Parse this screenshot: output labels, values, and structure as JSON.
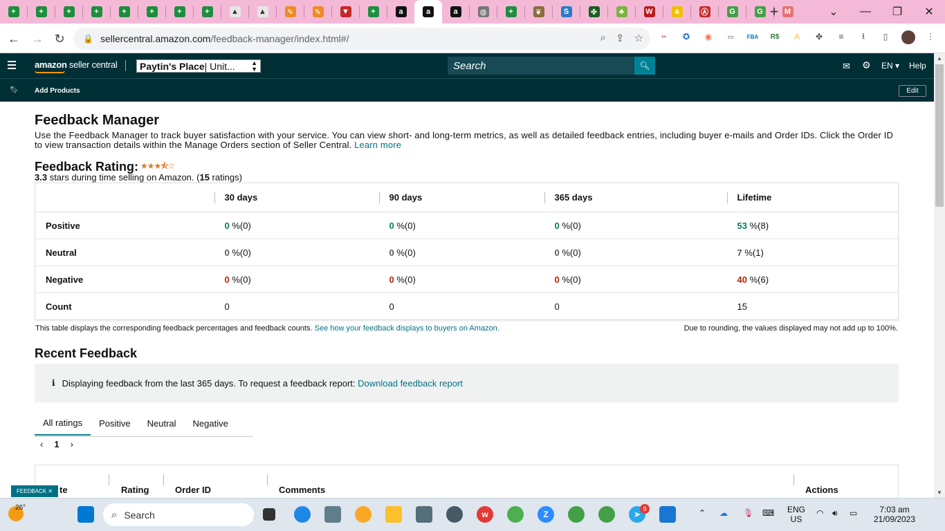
{
  "browser": {
    "url_host": "sellercentral.amazon.com",
    "url_path": "/feedback-manager/index.html#/",
    "tabs": [
      {
        "icon": "sheets-icon",
        "color": "#1e8e3e",
        "glyph": "+"
      },
      {
        "icon": "sheets-icon",
        "color": "#1e8e3e",
        "glyph": "+"
      },
      {
        "icon": "sheets-icon",
        "color": "#1e8e3e",
        "glyph": "+"
      },
      {
        "icon": "sheets-icon",
        "color": "#1e8e3e",
        "glyph": "+"
      },
      {
        "icon": "sheets-icon",
        "color": "#1e8e3e",
        "glyph": "+"
      },
      {
        "icon": "sheets-icon",
        "color": "#1e8e3e",
        "glyph": "+"
      },
      {
        "icon": "sheets-icon",
        "color": "#1e8e3e",
        "glyph": "+"
      },
      {
        "icon": "sheets-icon",
        "color": "#1e8e3e",
        "glyph": "+"
      },
      {
        "icon": "app-icon",
        "color": "#e6e6e6",
        "glyph": "▲"
      },
      {
        "icon": "app-icon",
        "color": "#e6e6e6",
        "glyph": "▲"
      },
      {
        "icon": "pen-icon",
        "color": "#f08a24",
        "glyph": "✎"
      },
      {
        "icon": "pen-icon",
        "color": "#f08a24",
        "glyph": "✎"
      },
      {
        "icon": "triangle-icon",
        "color": "#c62828",
        "glyph": "▼"
      },
      {
        "icon": "sheets-icon",
        "color": "#1e8e3e",
        "glyph": "+"
      },
      {
        "icon": "amazon-icon",
        "color": "#111111",
        "glyph": "a"
      },
      {
        "icon": "amazon-icon",
        "color": "#111111",
        "glyph": "a",
        "active": true
      },
      {
        "icon": "amazon-icon",
        "color": "#111111",
        "glyph": "a"
      },
      {
        "icon": "globe-icon",
        "color": "#777777",
        "glyph": "◍"
      },
      {
        "icon": "sheets-icon",
        "color": "#1e8e3e",
        "glyph": "+"
      },
      {
        "icon": "leaf-icon",
        "color": "#8a6d3b",
        "glyph": "❦"
      },
      {
        "icon": "sysco-icon",
        "color": "#2b7bc9",
        "glyph": "S"
      },
      {
        "icon": "puzzle-icon",
        "color": "#1b5e20",
        "glyph": "✤"
      },
      {
        "icon": "leaf-icon",
        "color": "#7cb342",
        "glyph": "♣"
      },
      {
        "icon": "ww-icon",
        "color": "#b71c1c",
        "glyph": "W"
      },
      {
        "icon": "amazon-icon",
        "color": "#f0c000",
        "glyph": "a"
      },
      {
        "icon": "circle-a-icon",
        "color": "#c62828",
        "glyph": "Ⓐ"
      },
      {
        "icon": "grocery-icon",
        "color": "#43a047",
        "glyph": "G"
      },
      {
        "icon": "grocery-icon",
        "color": "#43a047",
        "glyph": "G"
      },
      {
        "icon": "grocery-icon",
        "color": "#e57373",
        "glyph": "M"
      }
    ]
  },
  "header": {
    "logo_main": "amazon",
    "logo_sub": " seller central",
    "store_name": "Paytin's Place",
    "store_region": " | Unit...",
    "search_placeholder": "Search",
    "lang": "EN ▾",
    "help": "Help"
  },
  "subnav": {
    "add_products": "Add Products",
    "edit": "Edit"
  },
  "page": {
    "title": "Feedback Manager",
    "intro": "Use the Feedback Manager to track buyer satisfaction with your service. You can view short- and long-term metrics, as well as detailed feedback entries, including buyer e-mails and Order IDs. Click the Order ID to view transaction details within the Manage Orders section of Seller Central.",
    "learn_more": "Learn more",
    "rating_title": "Feedback Rating:",
    "rating_value": "3.3",
    "rating_text_a": " stars during time selling on Amazon. (",
    "rating_count": "15",
    "rating_text_b": " ratings)",
    "stars": "★★★⯪☆"
  },
  "feedback_table": {
    "columns": [
      "30 days",
      "90 days",
      "365 days",
      "Lifetime"
    ],
    "rows": [
      {
        "label": "Positive",
        "cls": "pos",
        "cells": [
          [
            "0",
            " %(0)"
          ],
          [
            "0",
            " %(0)"
          ],
          [
            "0",
            " %(0)"
          ],
          [
            "53",
            " %(8)"
          ]
        ]
      },
      {
        "label": "Neutral",
        "cls": "neu",
        "cells": [
          [
            "0",
            " %(0)"
          ],
          [
            "0",
            " %(0)"
          ],
          [
            "0",
            " %(0)"
          ],
          [
            "7",
            " %(1)"
          ]
        ]
      },
      {
        "label": "Negative",
        "cls": "neg",
        "cells": [
          [
            "0",
            " %(0)"
          ],
          [
            "0",
            " %(0)"
          ],
          [
            "0",
            " %(0)"
          ],
          [
            "40",
            " %(6)"
          ]
        ]
      },
      {
        "label": "Count",
        "cls": "",
        "cells": [
          [
            "",
            "0"
          ],
          [
            "",
            "0"
          ],
          [
            "",
            "0"
          ],
          [
            "",
            "15"
          ]
        ]
      }
    ],
    "note_left": "This table displays the corresponding feedback percentages and feedback counts.",
    "note_link": "See how your feedback displays to buyers on Amazon.",
    "note_right": "Due to rounding, the values displayed may not add up to 100%."
  },
  "recent": {
    "title": "Recent Feedback",
    "info_text": "Displaying feedback from the last 365 days. To request a feedback report:",
    "info_link": "Download feedback report",
    "tabs": [
      "All ratings",
      "Positive",
      "Neutral",
      "Negative"
    ],
    "page": "1",
    "columns": [
      "te",
      "Rating",
      "Order ID",
      "Comments",
      "Actions"
    ],
    "feedback_tab": "FEEDBACK ✕"
  },
  "taskbar": {
    "weather": "26°",
    "search": "Search",
    "lang_top": "ENG",
    "lang_bottom": "US",
    "time": "7:03 am",
    "date": "21/09/2023",
    "telegram_badge": "9"
  }
}
